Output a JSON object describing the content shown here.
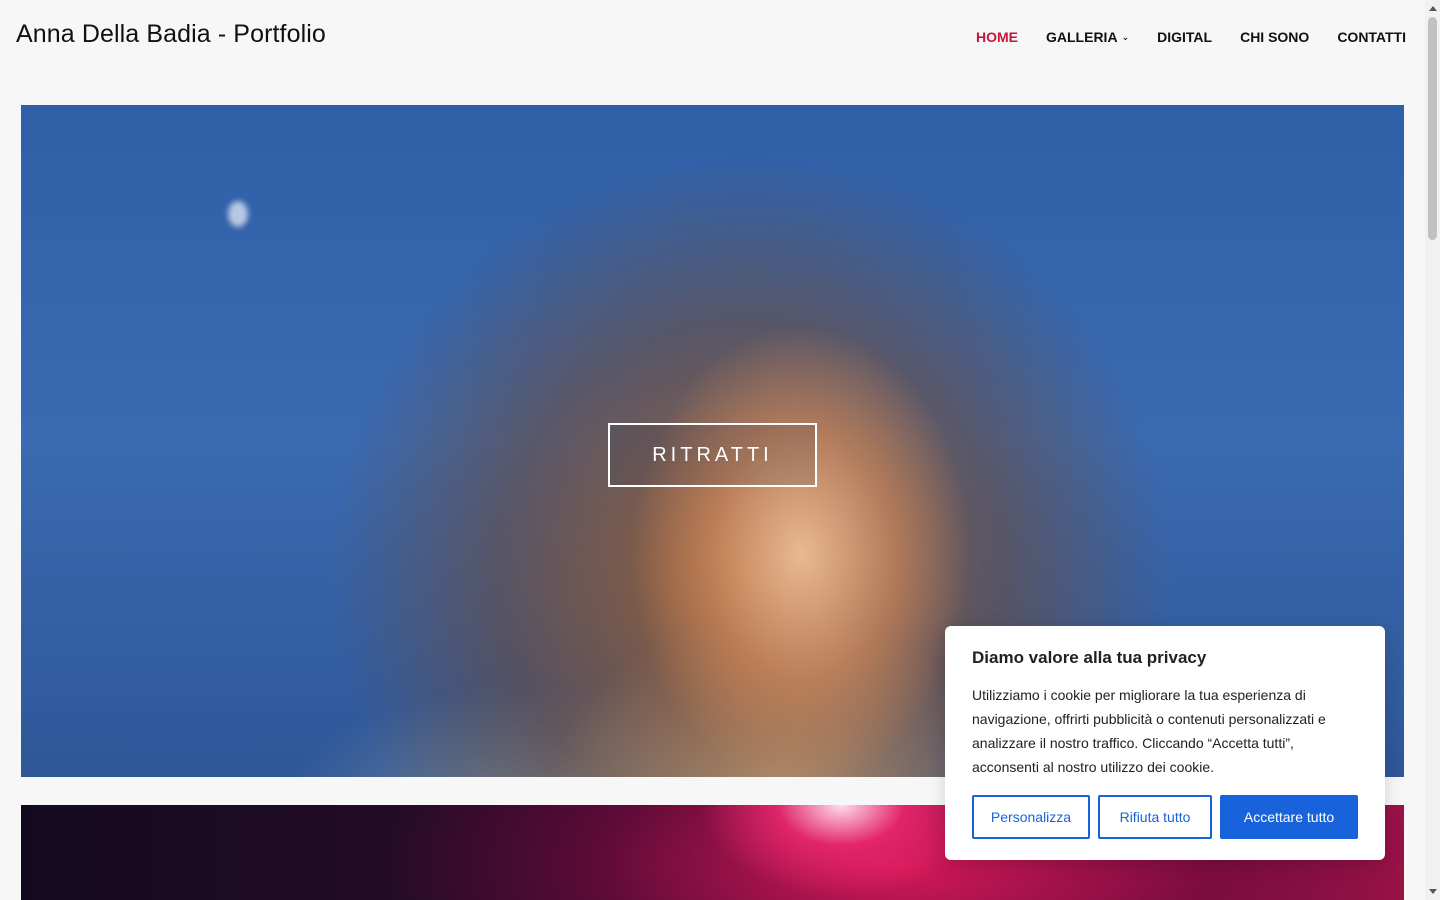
{
  "header": {
    "site_title": "Anna Della Badia - Portfolio",
    "nav": [
      {
        "label": "HOME",
        "active": true
      },
      {
        "label": "GALLERIA",
        "has_dropdown": true
      },
      {
        "label": "DIGITAL"
      },
      {
        "label": "CHI SONO"
      },
      {
        "label": "CONTATTI"
      }
    ],
    "active_color": "#c3163d"
  },
  "hero": {
    "button_label": "RITRATTI"
  },
  "cookie_banner": {
    "title": "Diamo valore alla tua privacy",
    "text": "Utilizziamo i cookie per migliorare la tua esperienza di navigazione, offrirti pubblicità o contenuti personalizzati e analizzare il nostro traffico. Cliccando “Accetta tutti”, acconsenti al nostro utilizzo dei cookie.",
    "buttons": {
      "customize": "Personalizza",
      "reject": "Rifiuta tutto",
      "accept": "Accettare tutto"
    },
    "accent_color": "#1863dc"
  },
  "icons": {
    "dropdown": "chevron-down-icon"
  }
}
